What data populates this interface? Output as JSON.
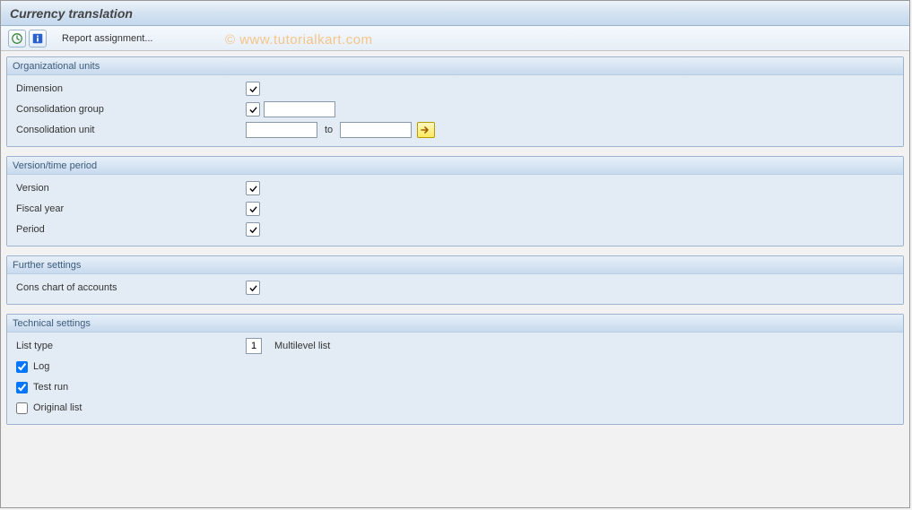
{
  "title": "Currency translation",
  "toolbar": {
    "report_assignment": "Report assignment..."
  },
  "watermark": "© www.tutorialkart.com",
  "groups": {
    "org": {
      "title": "Organizational units",
      "dimension_label": "Dimension",
      "cons_group_label": "Consolidation group",
      "cons_group_value": "",
      "cons_unit_label": "Consolidation unit",
      "cons_unit_from": "",
      "to_label": "to",
      "cons_unit_to": ""
    },
    "version": {
      "title": "Version/time period",
      "version_label": "Version",
      "fiscal_year_label": "Fiscal year",
      "period_label": "Period"
    },
    "further": {
      "title": "Further settings",
      "cons_chart_label": "Cons chart of accounts"
    },
    "tech": {
      "title": "Technical settings",
      "list_type_label": "List type",
      "list_type_value": "1",
      "list_type_desc": "Multilevel list",
      "log_label": "Log",
      "log_checked": true,
      "test_run_label": "Test run",
      "test_run_checked": true,
      "original_list_label": "Original list",
      "original_list_checked": false
    }
  }
}
